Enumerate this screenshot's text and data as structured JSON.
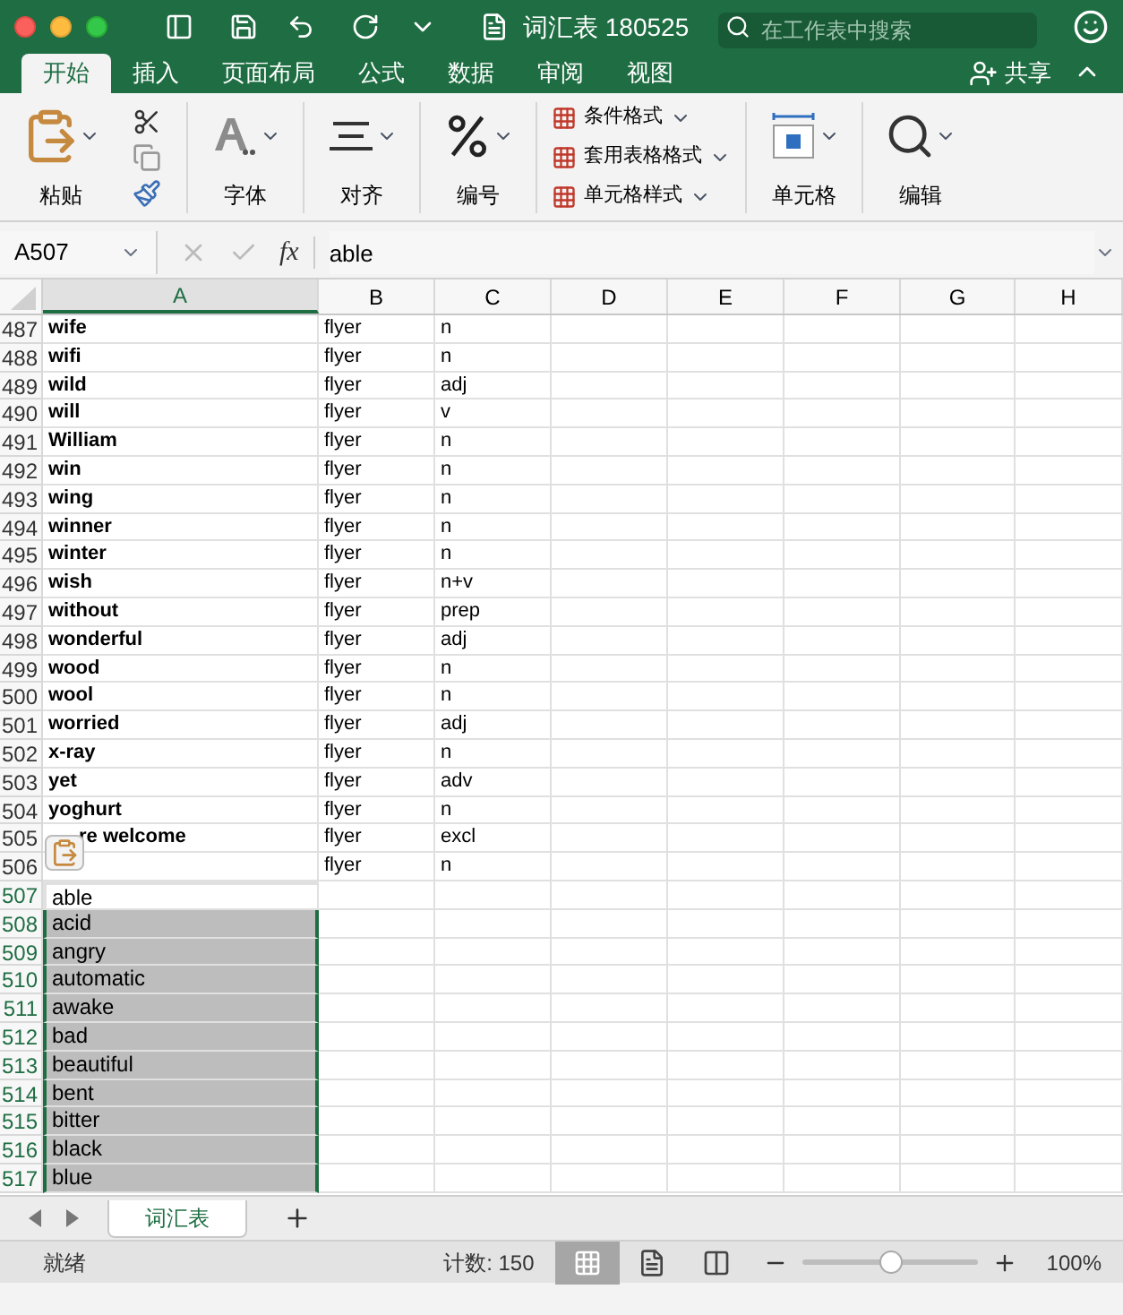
{
  "window": {
    "title": "词汇表 180525"
  },
  "search": {
    "placeholder": "在工作表中搜索"
  },
  "ribbon_tabs": [
    {
      "label": "开始",
      "selected": true
    },
    {
      "label": "插入",
      "selected": false
    },
    {
      "label": "页面布局",
      "selected": false
    },
    {
      "label": "公式",
      "selected": false
    },
    {
      "label": "数据",
      "selected": false
    },
    {
      "label": "审阅",
      "selected": false
    },
    {
      "label": "视图",
      "selected": false
    }
  ],
  "share": "共享",
  "ribbon": {
    "paste": "粘贴",
    "font": "字体",
    "align": "对齐",
    "number": "编号",
    "styles": [
      "条件格式",
      "套用表格格式",
      "单元格样式"
    ],
    "cells": "单元格",
    "edit": "编辑"
  },
  "formula_bar": {
    "name_box": "A507",
    "fx": "fx",
    "value": "able"
  },
  "columns": [
    {
      "label": "A",
      "selected": true
    },
    {
      "label": "B",
      "selected": false
    },
    {
      "label": "C",
      "selected": false
    },
    {
      "label": "D",
      "selected": false
    },
    {
      "label": "E",
      "selected": false
    },
    {
      "label": "F",
      "selected": false
    },
    {
      "label": "G",
      "selected": false
    },
    {
      "label": "H",
      "selected": false
    }
  ],
  "rows": [
    {
      "number": "487",
      "cells": [
        "wife",
        "flyer",
        "n"
      ],
      "bold": true,
      "selected": false,
      "active": false
    },
    {
      "number": "488",
      "cells": [
        "wifi",
        "flyer",
        "n"
      ],
      "bold": true,
      "selected": false,
      "active": false
    },
    {
      "number": "489",
      "cells": [
        "wild",
        "flyer",
        "adj"
      ],
      "bold": true,
      "selected": false,
      "active": false
    },
    {
      "number": "490",
      "cells": [
        "will",
        "flyer",
        "v"
      ],
      "bold": true,
      "selected": false,
      "active": false
    },
    {
      "number": "491",
      "cells": [
        "William",
        "flyer",
        "n"
      ],
      "bold": true,
      "selected": false,
      "active": false
    },
    {
      "number": "492",
      "cells": [
        "win",
        "flyer",
        "n"
      ],
      "bold": true,
      "selected": false,
      "active": false
    },
    {
      "number": "493",
      "cells": [
        "wing",
        "flyer",
        "n"
      ],
      "bold": true,
      "selected": false,
      "active": false
    },
    {
      "number": "494",
      "cells": [
        "winner",
        "flyer",
        "n"
      ],
      "bold": true,
      "selected": false,
      "active": false
    },
    {
      "number": "495",
      "cells": [
        "winter",
        "flyer",
        "n"
      ],
      "bold": true,
      "selected": false,
      "active": false
    },
    {
      "number": "496",
      "cells": [
        "wish",
        "flyer",
        "n+v"
      ],
      "bold": true,
      "selected": false,
      "active": false
    },
    {
      "number": "497",
      "cells": [
        "without",
        "flyer",
        "prep"
      ],
      "bold": true,
      "selected": false,
      "active": false
    },
    {
      "number": "498",
      "cells": [
        "wonderful",
        "flyer",
        "adj"
      ],
      "bold": true,
      "selected": false,
      "active": false
    },
    {
      "number": "499",
      "cells": [
        "wood",
        "flyer",
        "n"
      ],
      "bold": true,
      "selected": false,
      "active": false
    },
    {
      "number": "500",
      "cells": [
        "wool",
        "flyer",
        "n"
      ],
      "bold": true,
      "selected": false,
      "active": false
    },
    {
      "number": "501",
      "cells": [
        "worried",
        "flyer",
        "adj"
      ],
      "bold": true,
      "selected": false,
      "active": false
    },
    {
      "number": "502",
      "cells": [
        "x-ray",
        "flyer",
        "n"
      ],
      "bold": true,
      "selected": false,
      "active": false
    },
    {
      "number": "503",
      "cells": [
        "yet",
        "flyer",
        "adv"
      ],
      "bold": true,
      "selected": false,
      "active": false
    },
    {
      "number": "504",
      "cells": [
        "yoghurt",
        "flyer",
        "n"
      ],
      "bold": true,
      "selected": false,
      "active": false
    },
    {
      "number": "505",
      "cells": [
        "re welcome",
        "flyer",
        "excl"
      ],
      "bold": true,
      "selected": false,
      "active": false,
      "paste_options": true
    },
    {
      "number": "506",
      "cells": [
        "",
        "flyer",
        "n"
      ],
      "selected": false,
      "active": false
    },
    {
      "number": "507",
      "cells": [
        "able",
        "",
        ""
      ],
      "bold": false,
      "selected": true,
      "active": true
    },
    {
      "number": "508",
      "cells": [
        "acid",
        "",
        ""
      ],
      "bold": false,
      "selected": true,
      "active": false
    },
    {
      "number": "509",
      "cells": [
        "angry",
        "",
        ""
      ],
      "bold": false,
      "selected": true,
      "active": false
    },
    {
      "number": "510",
      "cells": [
        "automatic",
        "",
        ""
      ],
      "bold": false,
      "selected": true,
      "active": false
    },
    {
      "number": "511",
      "cells": [
        "awake",
        "",
        ""
      ],
      "bold": false,
      "selected": true,
      "active": false
    },
    {
      "number": "512",
      "cells": [
        "bad",
        "",
        ""
      ],
      "bold": false,
      "selected": true,
      "active": false
    },
    {
      "number": "513",
      "cells": [
        "beautiful",
        "",
        ""
      ],
      "bold": false,
      "selected": true,
      "active": false
    },
    {
      "number": "514",
      "cells": [
        "bent",
        "",
        ""
      ],
      "bold": false,
      "selected": true,
      "active": false
    },
    {
      "number": "515",
      "cells": [
        "bitter",
        "",
        ""
      ],
      "bold": false,
      "selected": true,
      "active": false
    },
    {
      "number": "516",
      "cells": [
        "black",
        "",
        ""
      ],
      "bold": false,
      "selected": true,
      "active": false
    },
    {
      "number": "517",
      "cells": [
        "blue",
        "",
        ""
      ],
      "bold": false,
      "selected": true,
      "active": false
    }
  ],
  "sheet_tabs": [
    {
      "label": "词汇表",
      "selected": true
    }
  ],
  "status_bar": {
    "status": "就绪",
    "count": "计数: 150",
    "views": [
      {
        "kind": "normal",
        "selected": true
      },
      {
        "kind": "page_layout",
        "selected": false
      },
      {
        "kind": "page_break",
        "selected": false
      }
    ],
    "zoom": {
      "level": 0.5,
      "reading": "100%"
    }
  }
}
